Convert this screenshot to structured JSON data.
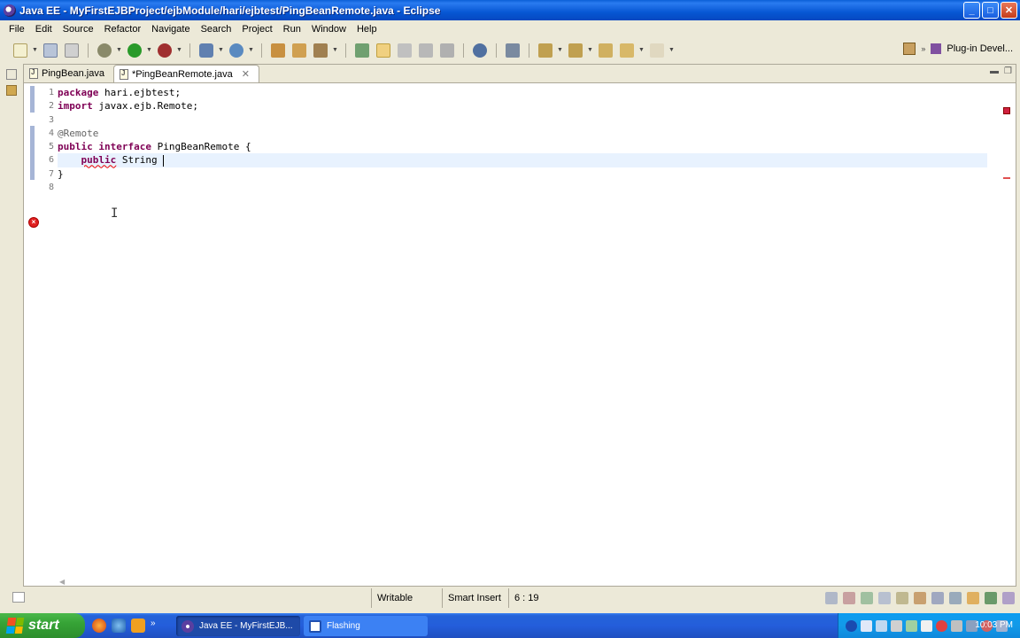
{
  "window": {
    "title": "Java EE - MyFirstEJBProject/ejbModule/hari/ejbtest/PingBeanRemote.java - Eclipse",
    "minimize": "_",
    "maximize": "□",
    "close": "✕"
  },
  "menu": [
    "File",
    "Edit",
    "Source",
    "Refactor",
    "Navigate",
    "Search",
    "Project",
    "Run",
    "Window",
    "Help"
  ],
  "perspective": {
    "label": "Plug-in Devel..."
  },
  "tabs": [
    {
      "label": "PingBean.java",
      "active": false
    },
    {
      "label": "*PingBeanRemote.java",
      "active": true,
      "close": "✕"
    }
  ],
  "editor": {
    "line_numbers": [
      "1",
      "2",
      "3",
      "4",
      "5",
      "6",
      "7",
      "8"
    ],
    "lines": {
      "l1_kw": "package",
      "l1_rest": " hari.ejbtest;",
      "l2_kw": "import",
      "l2_rest": " javax.ejb.Remote;",
      "l4_ann": "@Remote",
      "l5_kw1": "public",
      "l5_kw2": "interface",
      "l5_rest": " PingBeanRemote {",
      "l6_indent": "    ",
      "l6_kw": "public",
      "l6_rest": " String ",
      "l7": "}"
    },
    "error_marker": "×"
  },
  "status": {
    "writable": "Writable",
    "insert_mode": "Smart Insert",
    "position": "6 : 19"
  },
  "taskbar": {
    "start": "start",
    "buttons": [
      {
        "label": "Java EE - MyFirstEJB...",
        "active": true
      },
      {
        "label": "Flashing",
        "active": false
      }
    ],
    "clock": "10:03 PM",
    "overflow": "»"
  }
}
